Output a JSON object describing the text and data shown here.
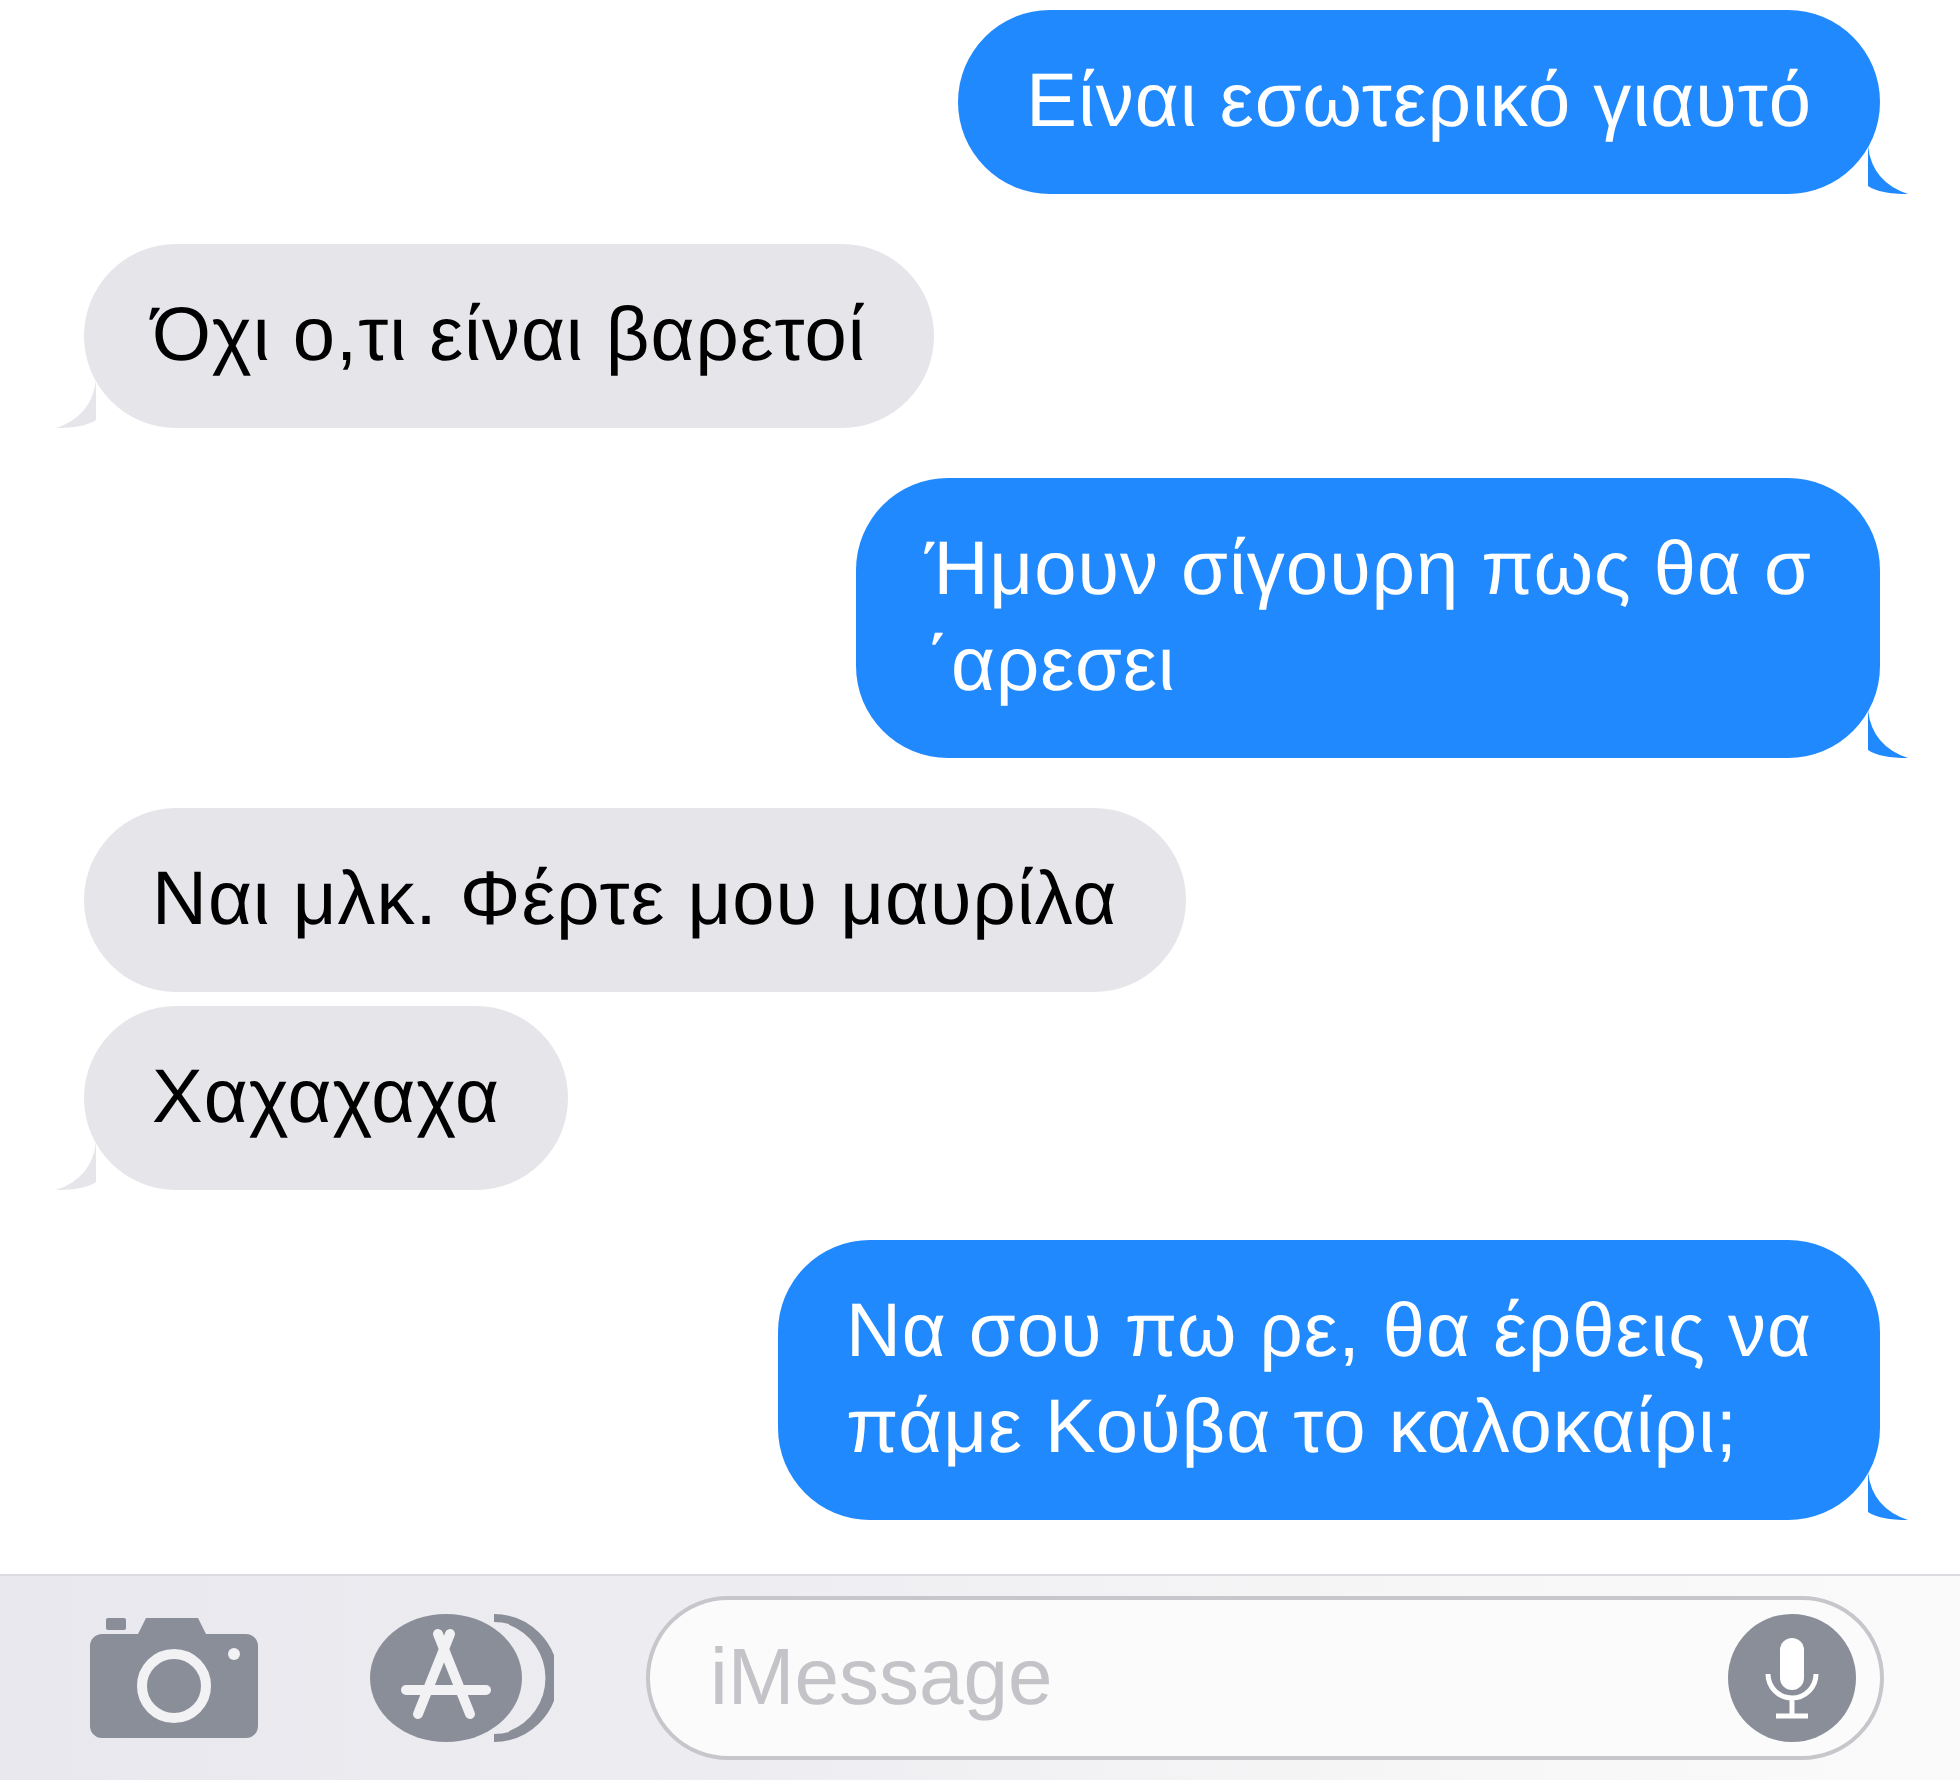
{
  "messages": [
    {
      "kind": "sent",
      "tail": true,
      "lines": [
        "Είναι εσωτερικό γιαυτό"
      ]
    },
    {
      "kind": "received",
      "tail": true,
      "lines": [
        "Όχι ο,τι είναι βαρετοί"
      ]
    },
    {
      "kind": "sent",
      "tail": true,
      "lines": [
        "Ήμουν σίγουρη πως θα σ",
        "΄αρεσει"
      ]
    },
    {
      "kind": "received",
      "tail": false,
      "lines": [
        "Ναι μλκ. Φέρτε μου μαυρίλα"
      ]
    },
    {
      "kind": "received",
      "tail": true,
      "lines": [
        "Χαχαχαχα"
      ]
    },
    {
      "kind": "sent",
      "tail": true,
      "lines": [
        "Να σου πω ρε, θα έρθεις να",
        "πάμε Κούβα το καλοκαίρι;"
      ]
    }
  ],
  "composer": {
    "placeholder": "iMessage"
  }
}
